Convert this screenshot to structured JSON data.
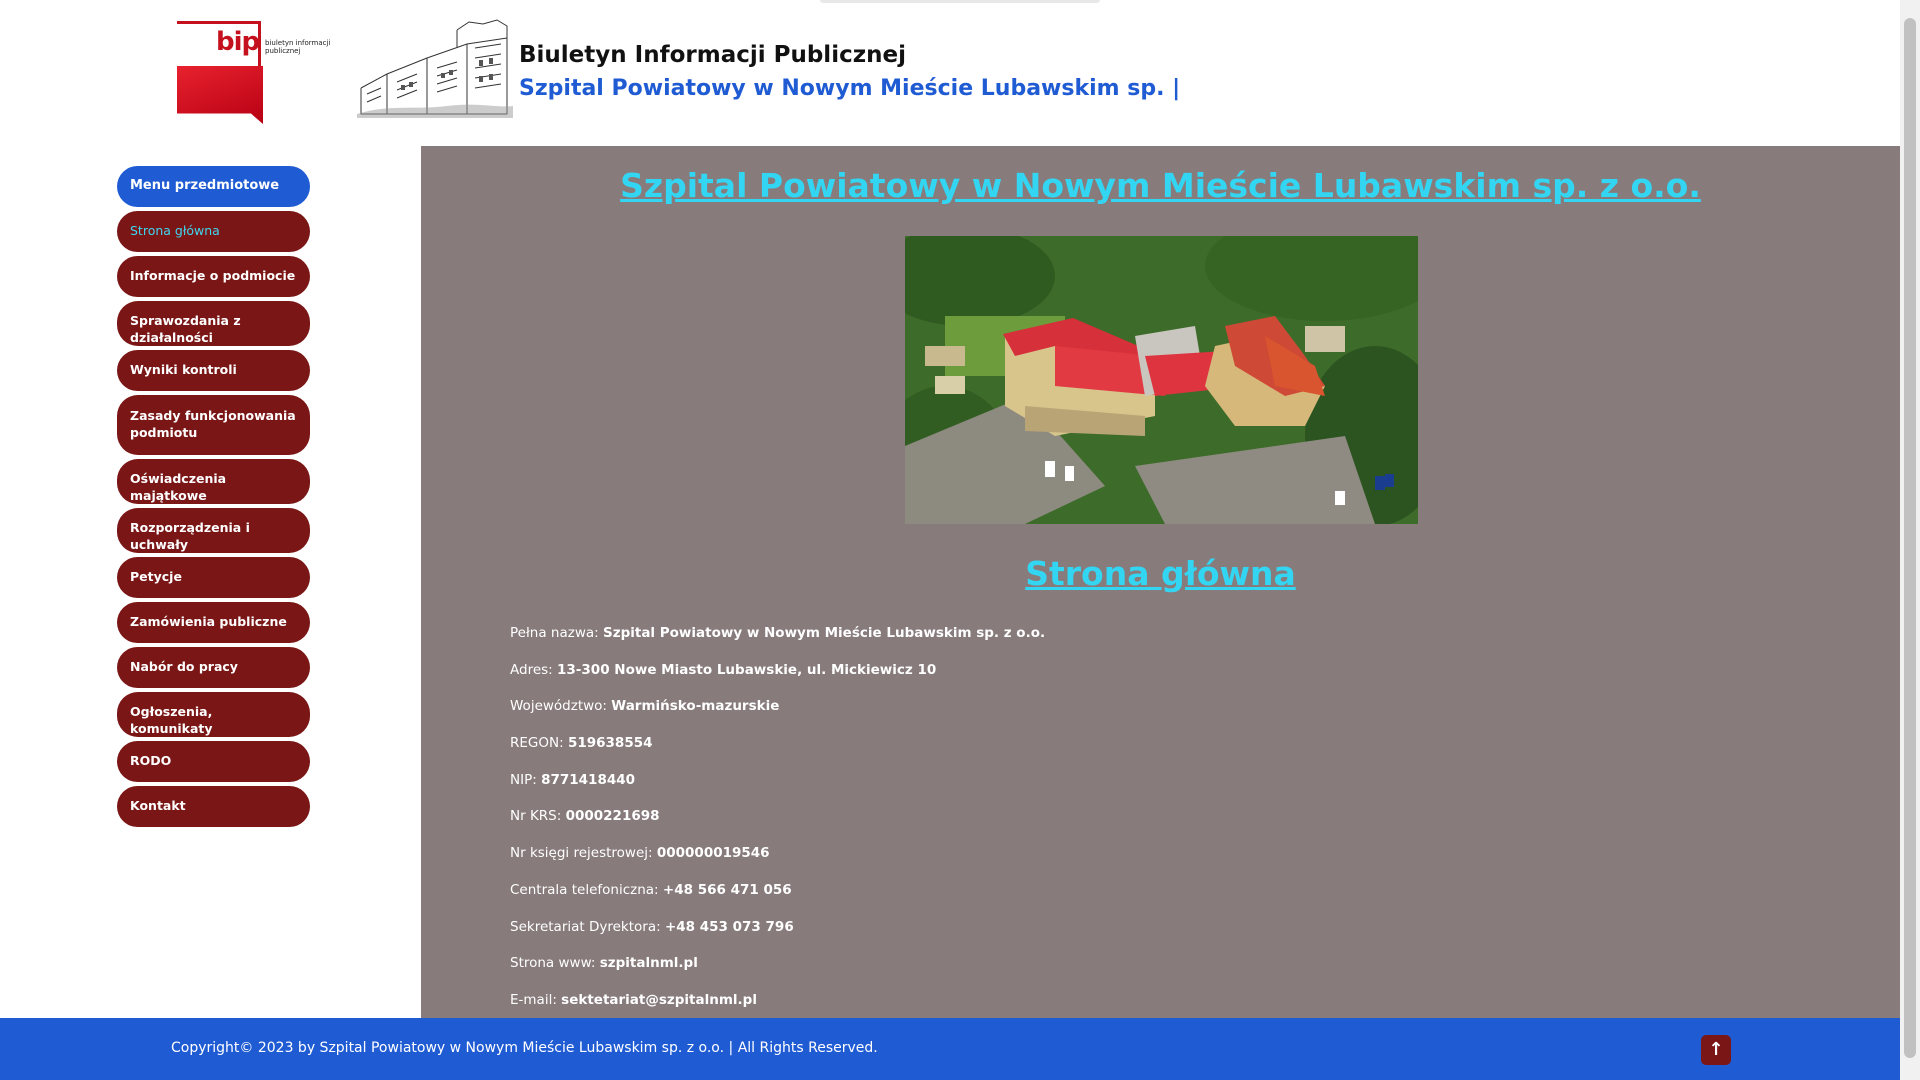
{
  "header": {
    "logo_text": "bip",
    "logo_subtext": "biuletyn informacji publicznej",
    "title_line1": "Biuletyn Informacji Publicznej",
    "title_line2": "Szpital Powiatowy w Nowym Mieście Lubawskim sp. |"
  },
  "sidebar": {
    "items": [
      {
        "label": "Menu przedmiotowe"
      },
      {
        "label": "Strona główna"
      },
      {
        "label": "Informacje o podmiocie"
      },
      {
        "label": "Sprawozdania z działalności"
      },
      {
        "label": "Wyniki kontroli"
      },
      {
        "label": "Zasady funkcjonowania podmiotu"
      },
      {
        "label": "Oświadczenia majątkowe"
      },
      {
        "label": "Rozporządzenia i uchwały"
      },
      {
        "label": "Petycje"
      },
      {
        "label": "Zamówienia publiczne"
      },
      {
        "label": "Nabór do pracy"
      },
      {
        "label": "Ogłoszenia, komunikaty"
      },
      {
        "label": "RODO"
      },
      {
        "label": "Kontakt"
      }
    ]
  },
  "main": {
    "title": "Szpital Powiatowy w Nowym Mieście Lubawskim sp. z o.o.",
    "section_title": "Strona główna",
    "info": [
      {
        "label": "Pełna nazwa:",
        "value": "Szpital Powiatowy w Nowym Mieście Lubawskim sp. z o.o."
      },
      {
        "label": "Adres:",
        "value": "13-300 Nowe Miasto Lubawskie, ul. Mickiewicz 10"
      },
      {
        "label": "Województwo:",
        "value": "Warmińsko-mazurskie"
      },
      {
        "label": "REGON:",
        "value": "519638554"
      },
      {
        "label": "NIP:",
        "value": "8771418440"
      },
      {
        "label": "Nr KRS:",
        "value": "0000221698"
      },
      {
        "label": "Nr księgi rejestrowej:",
        "value": "000000019546"
      },
      {
        "label": "Centrala telefoniczna:",
        "value": "+48 566 471 056"
      },
      {
        "label": "Sekretariat Dyrektora:",
        "value": "+48 453 073 796"
      },
      {
        "label": "Strona www:",
        "value": "szpitalnml.pl"
      },
      {
        "label": "E-mail:",
        "value": "sektetariat@szpitalnml.pl"
      }
    ]
  },
  "footer": {
    "copyright": "Copyright© 2023 by Szpital Powiatowy w Nowym Mieście Lubawskim sp. z o.o. | All Rights Reserved.",
    "to_top_icon": "arrow-up-icon",
    "to_top_glyph": "↑"
  },
  "colors": {
    "accent_blue": "#1f5bd3",
    "nav_red": "#7a1616",
    "link_cyan": "#33d6f2",
    "content_bg": "#877b7c"
  }
}
